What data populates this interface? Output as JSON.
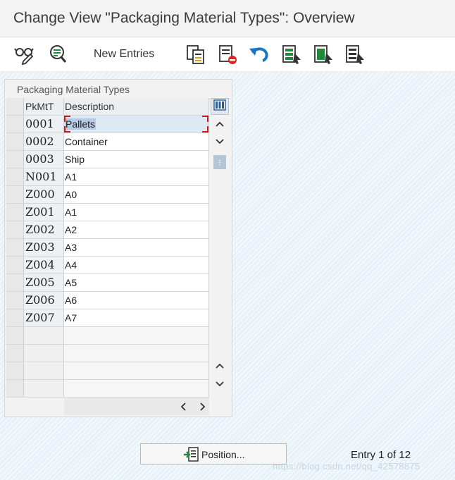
{
  "window": {
    "title": "Change View \"Packaging Material Types\": Overview"
  },
  "toolbar": {
    "new_entries_label": "New Entries",
    "icons": [
      "display-change-icon",
      "details-icon",
      "copy-icon",
      "delete-icon",
      "undo-icon",
      "select-all-icon",
      "select-block-icon",
      "deselect-all-icon"
    ]
  },
  "table": {
    "title": "Packaging Material Types",
    "columns": [
      "PkMtT",
      "Description"
    ],
    "rows": [
      {
        "key": "0001",
        "desc": "Pallets"
      },
      {
        "key": "0002",
        "desc": "Container"
      },
      {
        "key": "0003",
        "desc": "Ship"
      },
      {
        "key": "N001",
        "desc": "A1"
      },
      {
        "key": "Z000",
        "desc": "A0"
      },
      {
        "key": "Z001",
        "desc": "A1"
      },
      {
        "key": "Z002",
        "desc": "A2"
      },
      {
        "key": "Z003",
        "desc": "A3"
      },
      {
        "key": "Z004",
        "desc": "A4"
      },
      {
        "key": "Z005",
        "desc": "A5"
      },
      {
        "key": "Z006",
        "desc": "A6"
      },
      {
        "key": "Z007",
        "desc": "A7"
      }
    ],
    "empty_row_count": 4
  },
  "footer": {
    "position_label": "Position...",
    "entry_label": "Entry 1 of 12"
  },
  "watermark": "https://blog.csdn.net/qq_42578875",
  "colors": {
    "titlebar_bg": "#f3f3f3",
    "hatch_bg": "#e7f1f8",
    "selection": "#b7cbe4",
    "focus_red": "#cc1a1a",
    "accent_blue": "#1a74c6",
    "accent_green": "#1f8a3a"
  }
}
